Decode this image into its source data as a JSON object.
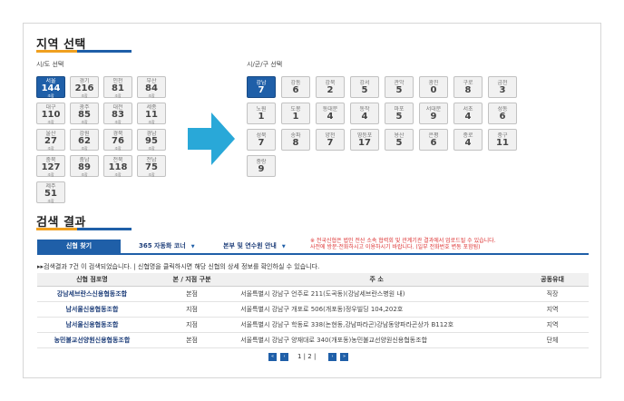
{
  "region_section": {
    "title": "지역 선택",
    "province_label": "시/도 선택",
    "district_label": "시/군/구 선택",
    "underline_colors": [
      "#f0a020",
      "#1f5fa8"
    ]
  },
  "provinces": [
    {
      "name": "서울",
      "count": "144",
      "unit": "조합",
      "active": true
    },
    {
      "name": "경기",
      "count": "216",
      "unit": "조합",
      "active": false
    },
    {
      "name": "인천",
      "count": "81",
      "unit": "조합",
      "active": false
    },
    {
      "name": "부산",
      "count": "84",
      "unit": "조합",
      "active": false
    },
    {
      "name": "대구",
      "count": "110",
      "unit": "조합",
      "active": false
    },
    {
      "name": "광주",
      "count": "85",
      "unit": "조합",
      "active": false
    },
    {
      "name": "대전",
      "count": "83",
      "unit": "조합",
      "active": false
    },
    {
      "name": "세종",
      "count": "11",
      "unit": "조합",
      "active": false
    },
    {
      "name": "울산",
      "count": "27",
      "unit": "조합",
      "active": false
    },
    {
      "name": "강원",
      "count": "62",
      "unit": "조합",
      "active": false
    },
    {
      "name": "경북",
      "count": "76",
      "unit": "조합",
      "active": false
    },
    {
      "name": "경남",
      "count": "95",
      "unit": "조합",
      "active": false
    },
    {
      "name": "충북",
      "count": "127",
      "unit": "조합",
      "active": false
    },
    {
      "name": "충남",
      "count": "89",
      "unit": "조합",
      "active": false
    },
    {
      "name": "전북",
      "count": "118",
      "unit": "조합",
      "active": false
    },
    {
      "name": "전남",
      "count": "75",
      "unit": "조합",
      "active": false
    },
    {
      "name": "제주",
      "count": "51",
      "unit": "조합",
      "active": false
    }
  ],
  "districts": [
    {
      "name": "강남",
      "count": "7",
      "active": true
    },
    {
      "name": "강동",
      "count": "6",
      "active": false
    },
    {
      "name": "강북",
      "count": "2",
      "active": false
    },
    {
      "name": "강서",
      "count": "5",
      "active": false
    },
    {
      "name": "관악",
      "count": "5",
      "active": false
    },
    {
      "name": "광진",
      "count": "0",
      "active": false
    },
    {
      "name": "구로",
      "count": "8",
      "active": false
    },
    {
      "name": "금천",
      "count": "3",
      "active": false
    },
    {
      "name": "노원",
      "count": "1",
      "active": false
    },
    {
      "name": "도봉",
      "count": "1",
      "active": false
    },
    {
      "name": "동대문",
      "count": "4",
      "active": false
    },
    {
      "name": "동작",
      "count": "4",
      "active": false
    },
    {
      "name": "마포",
      "count": "5",
      "active": false
    },
    {
      "name": "서대문",
      "count": "9",
      "active": false
    },
    {
      "name": "서초",
      "count": "4",
      "active": false
    },
    {
      "name": "성동",
      "count": "6",
      "active": false
    },
    {
      "name": "성북",
      "count": "7",
      "active": false
    },
    {
      "name": "송파",
      "count": "8",
      "active": false
    },
    {
      "name": "양천",
      "count": "7",
      "active": false
    },
    {
      "name": "영등포",
      "count": "17",
      "active": false
    },
    {
      "name": "용산",
      "count": "5",
      "active": false
    },
    {
      "name": "은평",
      "count": "6",
      "active": false
    },
    {
      "name": "종로",
      "count": "4",
      "active": false
    },
    {
      "name": "중구",
      "count": "11",
      "active": false
    },
    {
      "name": "중랑",
      "count": "9",
      "active": false
    }
  ],
  "results_section": {
    "title": "검색 결과",
    "tabs": [
      {
        "label": "신협 찾기"
      },
      {
        "label": "365 자동화 코너"
      },
      {
        "label": "본부 및 연수원 안내"
      }
    ],
    "dropdown_glyph": "▼",
    "notice_line1": "※ 전국신협은 법인 전산 소속 협력회 및 관계기관 결과에서 업로드될 수 있습니다.",
    "notice_line2": "사전에 방문·전화하시고 이용하시기 바랍니다. (일부 전화번호 변동 포함됨)",
    "summary": "▸▸검색결과 7건 이 검색되었습니다. | 신협명을 클릭하시면 해당 신협의 상세 정보를 확인하실 수 있습니다.",
    "columns": [
      "신협 점포명",
      "본 / 지점 구분",
      "주 소",
      "공동유대"
    ],
    "rows": [
      {
        "name": "강남세브란스신용협동조합",
        "type": "본점",
        "address": "서울특별시 강남구 언주로 211(도곡동)(강남세브란스병원 내)",
        "bond": "직장"
      },
      {
        "name": "남서울신용협동조합",
        "type": "지점",
        "address": "서울특별시 강남구 개포로 506(개포동)정우빌딩 104,202호",
        "bond": "지역"
      },
      {
        "name": "남서울신용협동조합",
        "type": "지점",
        "address": "서울특별시 강남구 학동로 338(논현동,강남파라곤)강남동양파라곤상가 B112호",
        "bond": "지역"
      },
      {
        "name": "농민불교선양원신용협동조합",
        "type": "본점",
        "address": "서울특별시 강남구 양재대로 340(개포동)농민불교선양원신용협동조합",
        "bond": "단체"
      }
    ],
    "pagination": {
      "first": "«",
      "prev": "‹",
      "pages": "1 | 2 |",
      "next": "›",
      "last": "»"
    }
  },
  "colors": {
    "accent": "#1f5fa8",
    "arrow": "#29a8d8",
    "notice": "#d33333"
  }
}
